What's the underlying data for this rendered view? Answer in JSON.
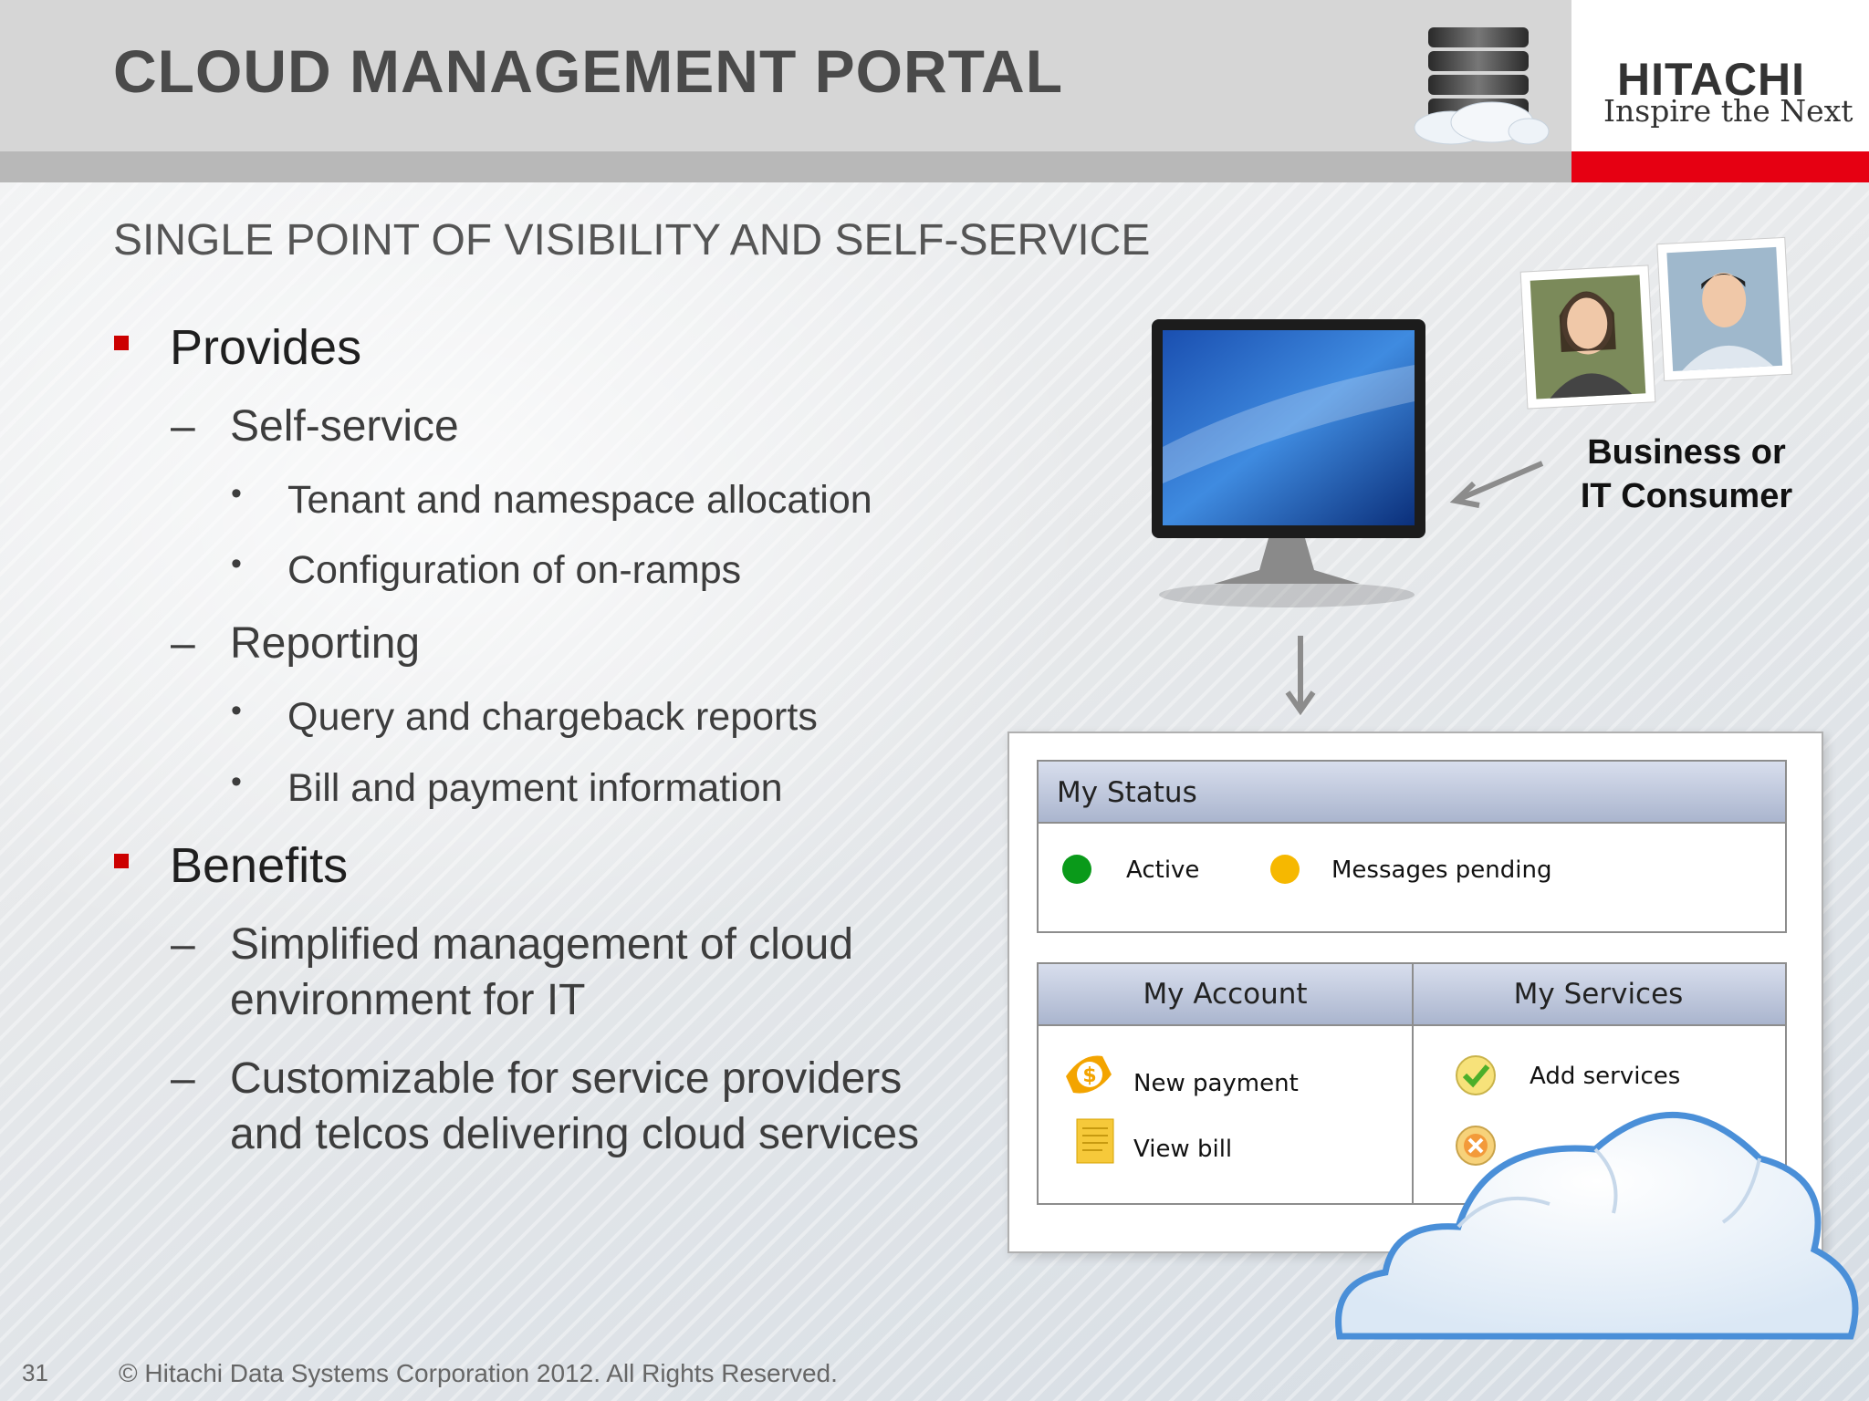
{
  "header": {
    "title": "CLOUD MANAGEMENT PORTAL",
    "logo_word": "HITACHI",
    "logo_tagline": "Inspire the Next"
  },
  "subtitle": "SINGLE POINT OF VISIBILITY AND SELF-SERVICE",
  "bullets": {
    "provides": {
      "label": "Provides",
      "self_service": {
        "label": "Self-service",
        "items": [
          "Tenant and namespace allocation",
          "Configuration of on-ramps"
        ]
      },
      "reporting": {
        "label": "Reporting",
        "items": [
          "Query and chargeback reports",
          "Bill and payment information"
        ]
      }
    },
    "benefits": {
      "label": "Benefits",
      "items": [
        "Simplified management of cloud environment for IT",
        "Customizable for service providers and telcos delivering cloud services"
      ]
    }
  },
  "illustration": {
    "consumer_label": "Business or IT Consumer"
  },
  "portal": {
    "status_title": "My Status",
    "status_items": [
      {
        "label": "Active",
        "color": "#0a9a1a"
      },
      {
        "label": "Messages pending",
        "color": "#f6b800"
      }
    ],
    "account_title": "My Account",
    "account_items": [
      "New payment",
      "View bill"
    ],
    "services_title": "My Services",
    "services_items": [
      "Add services"
    ]
  },
  "colors": {
    "accent_red": "#e60012",
    "bullet_red": "#cc0000"
  },
  "footer": {
    "page_number": "31",
    "copyright": "© Hitachi Data Systems Corporation 2012. All Rights Reserved."
  }
}
